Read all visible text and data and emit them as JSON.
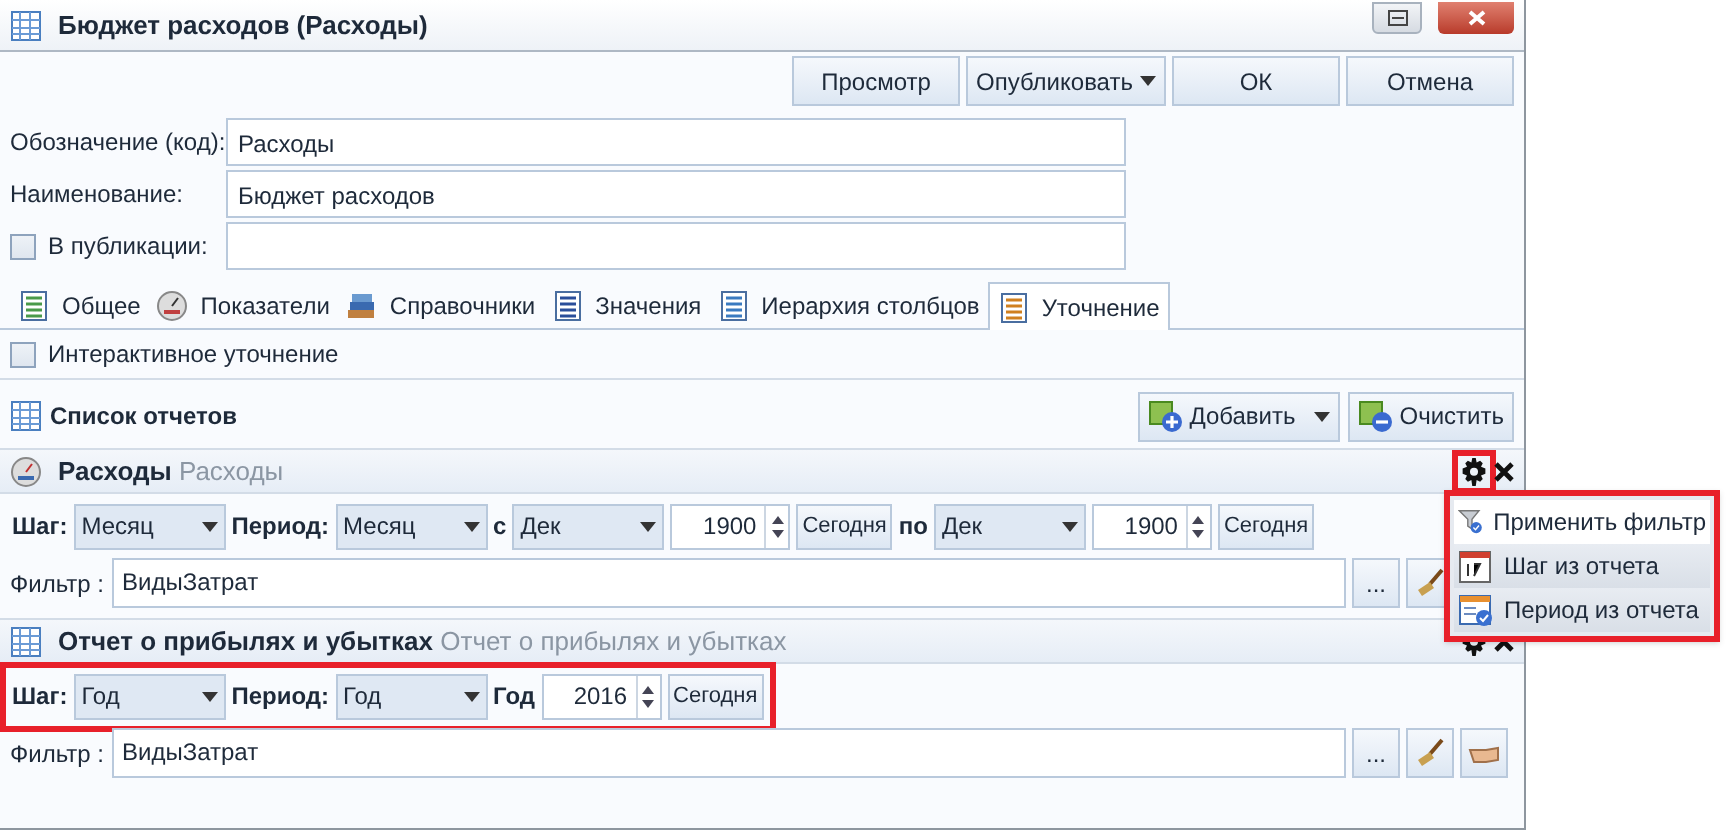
{
  "window": {
    "title": "Бюджет расходов (Расходы)"
  },
  "toolbar": [
    {
      "label": "Просмотр",
      "kind": "button"
    },
    {
      "label": "Опубликовать",
      "kind": "dropdown"
    },
    {
      "label": "ОК",
      "kind": "button"
    },
    {
      "label": "Отмена",
      "kind": "button"
    }
  ],
  "fields": [
    {
      "kind": "text",
      "label": "Обозначение (код):",
      "value": "Расходы"
    },
    {
      "kind": "text",
      "label": "Наименование:",
      "value": "Бюджет расходов"
    },
    {
      "kind": "checkbox",
      "label": "В публикации:",
      "checked": false
    }
  ],
  "tabs": [
    {
      "label": "Общее",
      "selected": false
    },
    {
      "label": "Показатели",
      "selected": false
    },
    {
      "label": "Справочники",
      "selected": false
    },
    {
      "label": "Значения",
      "selected": false
    },
    {
      "label": "Иерархия столбцов",
      "selected": false
    },
    {
      "label": "Уточнение",
      "selected": true
    }
  ],
  "interactive": {
    "label": "Интерактивное уточнение",
    "checked": false
  },
  "reports_list": {
    "title": "Список отчетов",
    "buttons": [
      {
        "label": "Добавить",
        "kind": "add",
        "dropdown": true
      },
      {
        "label": "Очистить",
        "kind": "clear",
        "dropdown": false
      }
    ]
  },
  "reports": [
    {
      "title": "Расходы",
      "subtitle": "Расходы",
      "gear_highlighted": true,
      "controls_highlighted": false,
      "controls": [
        {
          "kind": "label",
          "text": "Шаг:"
        },
        {
          "kind": "select",
          "text": "Месяц"
        },
        {
          "kind": "label",
          "text": "Период:"
        },
        {
          "kind": "select",
          "text": "Месяц"
        },
        {
          "kind": "label",
          "text": "с"
        },
        {
          "kind": "select",
          "text": "Дек"
        },
        {
          "kind": "spin",
          "text": "1900"
        },
        {
          "kind": "button",
          "text": "Сегодня"
        },
        {
          "kind": "label",
          "text": "по"
        },
        {
          "kind": "select",
          "text": "Дек"
        },
        {
          "kind": "spin",
          "text": "1900"
        },
        {
          "kind": "button",
          "text": "Сегодня"
        }
      ],
      "filter_label": "Фильтр :",
      "filter_value": "ВидыЗатрат",
      "filter_button": "...",
      "filter_tools": [
        {
          "kind": "broom"
        }
      ]
    },
    {
      "title": "Отчет о прибылях и убытках",
      "subtitle": "Отчет о прибылях и убытках",
      "gear_highlighted": false,
      "controls_highlighted": true,
      "controls": [
        {
          "kind": "label",
          "text": "Шаг:"
        },
        {
          "kind": "select",
          "text": "Год"
        },
        {
          "kind": "label",
          "text": "Период:"
        },
        {
          "kind": "select",
          "text": "Год"
        },
        {
          "kind": "label",
          "text": "Год"
        },
        {
          "kind": "spin",
          "text": "2016"
        },
        {
          "kind": "button",
          "text": "Сегодня"
        }
      ],
      "filter_label": "Фильтр :",
      "filter_value": "ВидыЗатрат",
      "filter_button": "...",
      "filter_tools": [
        {
          "kind": "broom"
        },
        {
          "kind": "hand"
        }
      ]
    }
  ],
  "context_menu": {
    "highlighted": true,
    "items": [
      {
        "label": "Применить фильтр",
        "kind": "filter",
        "selected": true
      },
      {
        "label": "Шаг из отчета",
        "kind": "step",
        "selected": false
      },
      {
        "label": "Период из отчета",
        "kind": "period",
        "selected": false
      }
    ]
  }
}
